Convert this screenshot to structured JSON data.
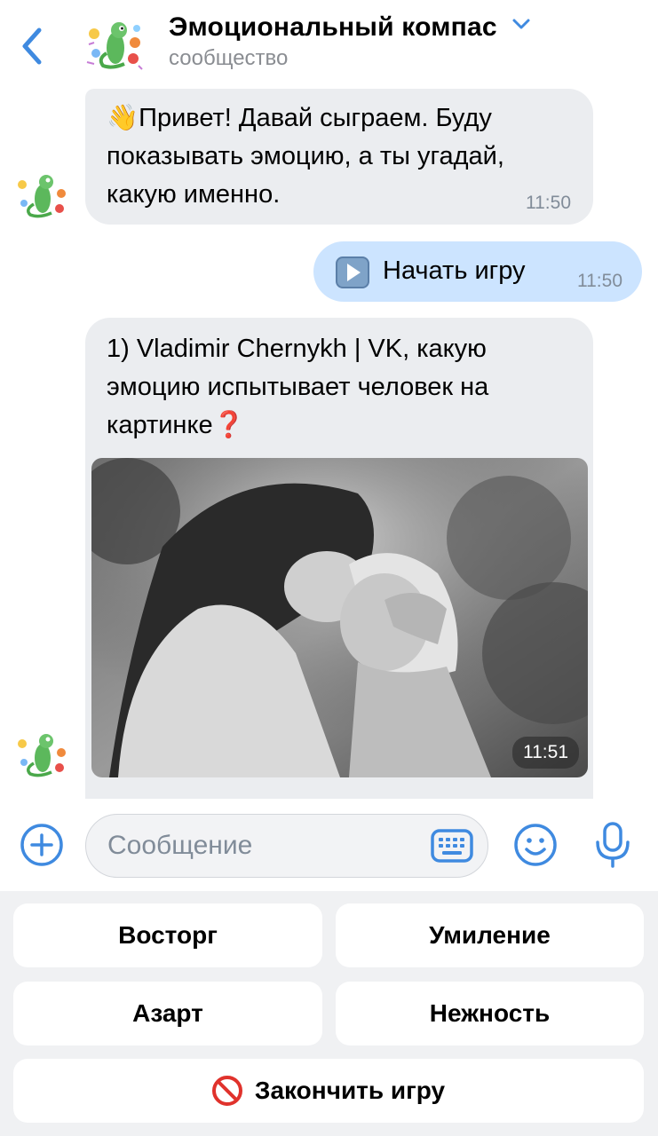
{
  "header": {
    "title": "Эмоциональный компас",
    "subtitle": "сообщество"
  },
  "messages": [
    {
      "id": "m1",
      "direction": "incoming",
      "emoji": "👋",
      "text": "Привет! Давай сыграем. Буду показывать эмоцию, а ты угадай, какую именно.",
      "time": "11:50"
    },
    {
      "id": "m2",
      "direction": "outgoing",
      "icon": "play-button-icon",
      "text": "Начать игру",
      "time": "11:50"
    },
    {
      "id": "m3",
      "direction": "incoming",
      "text": "1) Vladimir Chernykh | VK, какую эмоцию испытывает человек на картинке",
      "emoji": "❓",
      "time": "11:51"
    }
  ],
  "input": {
    "placeholder": "Сообщение"
  },
  "keyboard": {
    "buttons": [
      "Восторг",
      "Умиление",
      "Азарт",
      "Нежность"
    ],
    "end_button": "Закончить игру"
  },
  "colors": {
    "accent": "#3f8ae0",
    "incoming_bubble": "#ebedf0",
    "outgoing_bubble": "#cce4ff",
    "time_text": "#818c99",
    "keyboard_bg": "#f0f1f3"
  }
}
